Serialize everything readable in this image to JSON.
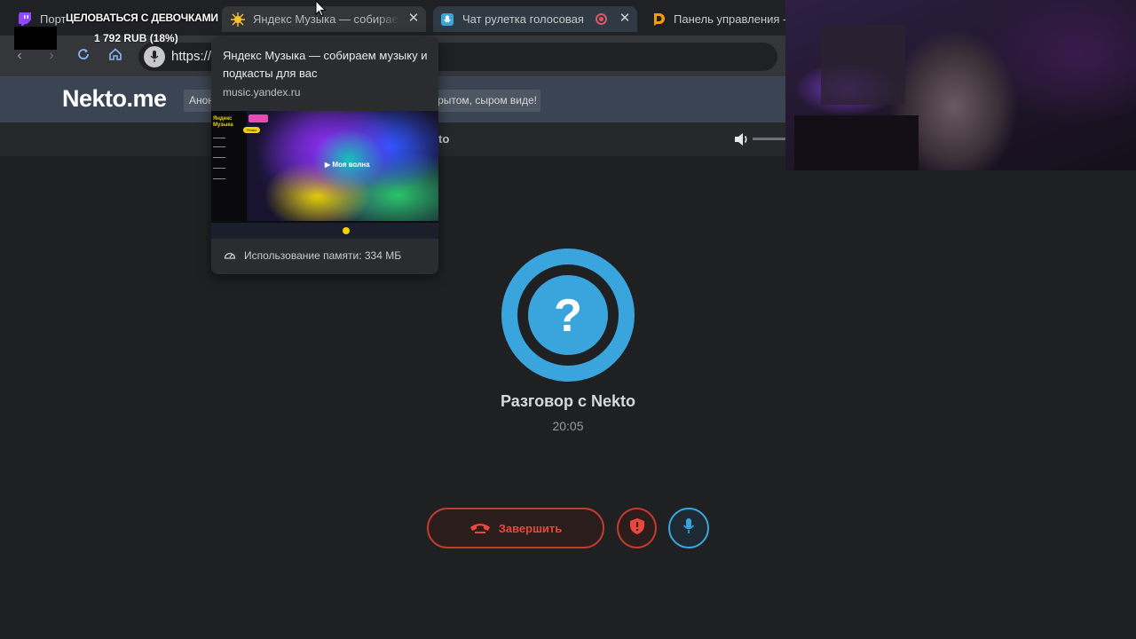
{
  "browser": {
    "tabs": [
      {
        "title": "Порт",
        "favicon": "twitch-icon"
      },
      {
        "title": "Яндекс Музыка — собираем музыку и подкасты для вас",
        "favicon": "yandex-music-icon"
      },
      {
        "title": "Чат рулетка голосовая — ",
        "favicon": "nekto-icon"
      },
      {
        "title": "Панель управления - D",
        "favicon": "donationalerts-icon"
      }
    ],
    "address": "https://"
  },
  "overlay": {
    "alert_title": "ЦЕЛОВАТЬСЯ С ДЕВОЧКАМИ",
    "alert_amount": "1 792 RUB (18%)"
  },
  "hovercard": {
    "title": "Яндекс Музыка — собираем музыку и подкасты для вас",
    "domain": "music.yandex.ru",
    "memory": "Использование памяти: 334 МБ",
    "preview_wave": "▶ Моя волна"
  },
  "site": {
    "logo": "Nekto.me",
    "notice_left": "Анон",
    "notice_right": "крытом, сыром виде!",
    "subbar_fragment": "to"
  },
  "call": {
    "avatar_symbol": "?",
    "title": "Разговор с Nekto",
    "timer": "20:05",
    "end_label": "Завершить"
  },
  "colors": {
    "accent": "#3aa4dd",
    "danger": "#e8473a",
    "background": "#1f2022"
  }
}
